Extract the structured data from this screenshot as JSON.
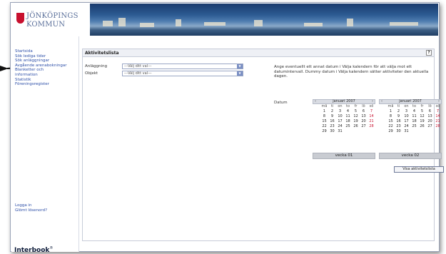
{
  "logo": {
    "line1": "JÖNKÖPINGS",
    "line2": "KOMMUN"
  },
  "sidebar": {
    "items": [
      {
        "label": "Startsida"
      },
      {
        "label": "Sök lediga tider"
      },
      {
        "label": "Sök anläggningar"
      },
      {
        "label": "Avgående arenabokningar"
      },
      {
        "label": "Blanketter och"
      },
      {
        "label": "information"
      },
      {
        "label": "Statistik"
      },
      {
        "label": "Föreningsregister"
      }
    ],
    "logout": [
      "Logga in",
      "Glömt lösenord?"
    ],
    "brand": "Interbook",
    "brand_mark": "®"
  },
  "main": {
    "title": "Aktivitetslista",
    "help": "?",
    "form": {
      "facility_label": "Anläggning",
      "facility_value": "---Välj ditt val---",
      "object_label": "Objekt",
      "object_value": "---Välj ditt val---"
    },
    "info_text": "Ange eventuellt ett annat datum i Välja kalendern för att välja mot ett datumintervall. Dummy datum i Välja kalendern sätter aktiviteter den aktuella dagen.",
    "date_label": "Datum",
    "cal1": {
      "nav_prev": "‹",
      "nav_next": "›",
      "header": "januari 2007",
      "weekdays": [
        "",
        "må",
        "ti",
        "on",
        "to",
        "fr",
        "lö",
        "sö"
      ],
      "rows": [
        [
          "",
          "1",
          "2",
          "3",
          "4",
          "5",
          "6",
          "7"
        ],
        [
          "",
          "8",
          "9",
          "10",
          "11",
          "12",
          "13",
          "14"
        ],
        [
          "",
          "15",
          "16",
          "17",
          "18",
          "19",
          "20",
          "21"
        ],
        [
          "",
          "22",
          "23",
          "24",
          "25",
          "26",
          "27",
          "28"
        ],
        [
          "",
          "29",
          "30",
          "31",
          "",
          "",
          "",
          ""
        ],
        [
          "",
          "",
          "",
          "",
          "",
          "",
          "",
          ""
        ]
      ]
    },
    "cal2": {
      "nav_prev": "‹",
      "nav_next": "›",
      "header": "januari 2007",
      "weekdays": [
        "",
        "må",
        "ti",
        "on",
        "to",
        "fr",
        "lö",
        "sö"
      ],
      "rows": [
        [
          "",
          "1",
          "2",
          "3",
          "4",
          "5",
          "6",
          "7"
        ],
        [
          "",
          "8",
          "9",
          "10",
          "11",
          "12",
          "13",
          "14"
        ],
        [
          "",
          "15",
          "16",
          "17",
          "18",
          "19",
          "20",
          "21"
        ],
        [
          "",
          "22",
          "23",
          "24",
          "25",
          "26",
          "27",
          "28"
        ],
        [
          "",
          "29",
          "30",
          "31",
          "",
          "",
          "",
          ""
        ],
        [
          "",
          "",
          "",
          "",
          "",
          "",
          "",
          ""
        ]
      ]
    },
    "week1": "vecka 01",
    "week2": "vecka 02",
    "show_button": "Visa aktivitetslista"
  },
  "colors": {
    "accent": "#2d4fa8",
    "brand_red": "#c8102e",
    "select_arrow": "#7a8fc4"
  }
}
